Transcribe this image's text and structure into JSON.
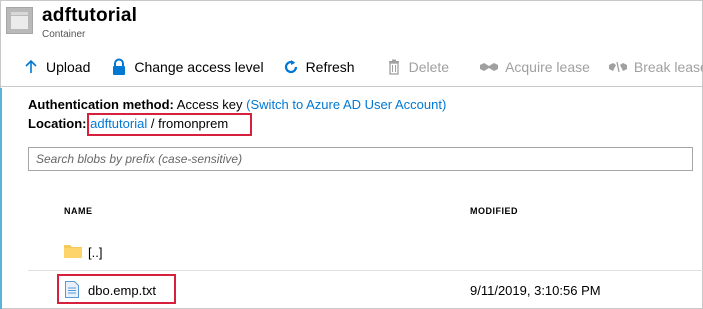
{
  "header": {
    "title": "adftutorial",
    "subtitle": "Container"
  },
  "toolbar": {
    "upload": "Upload",
    "change_access": "Change access level",
    "refresh": "Refresh",
    "delete": "Delete",
    "acquire_lease": "Acquire lease",
    "break_lease": "Break lease"
  },
  "info": {
    "auth_label": "Authentication method:",
    "auth_value": "Access key",
    "auth_switch": "(Switch to Azure AD User Account)",
    "location_label": "Location:",
    "location_container": "adftutorial",
    "location_sep": "/",
    "location_folder": "fromonprem"
  },
  "search": {
    "placeholder": "Search blobs by prefix (case-sensitive)"
  },
  "table": {
    "columns": [
      "NAME",
      "MODIFIED"
    ],
    "rows": [
      {
        "name": "[..]",
        "modified": "",
        "icon": "folder-icon"
      },
      {
        "name": "dbo.emp.txt",
        "modified": "9/11/2019, 3:10:56 PM",
        "icon": "file-icon"
      }
    ]
  },
  "colors": {
    "accent": "#0078d4",
    "highlight": "#d6203c",
    "folder": "#f5c95a"
  }
}
